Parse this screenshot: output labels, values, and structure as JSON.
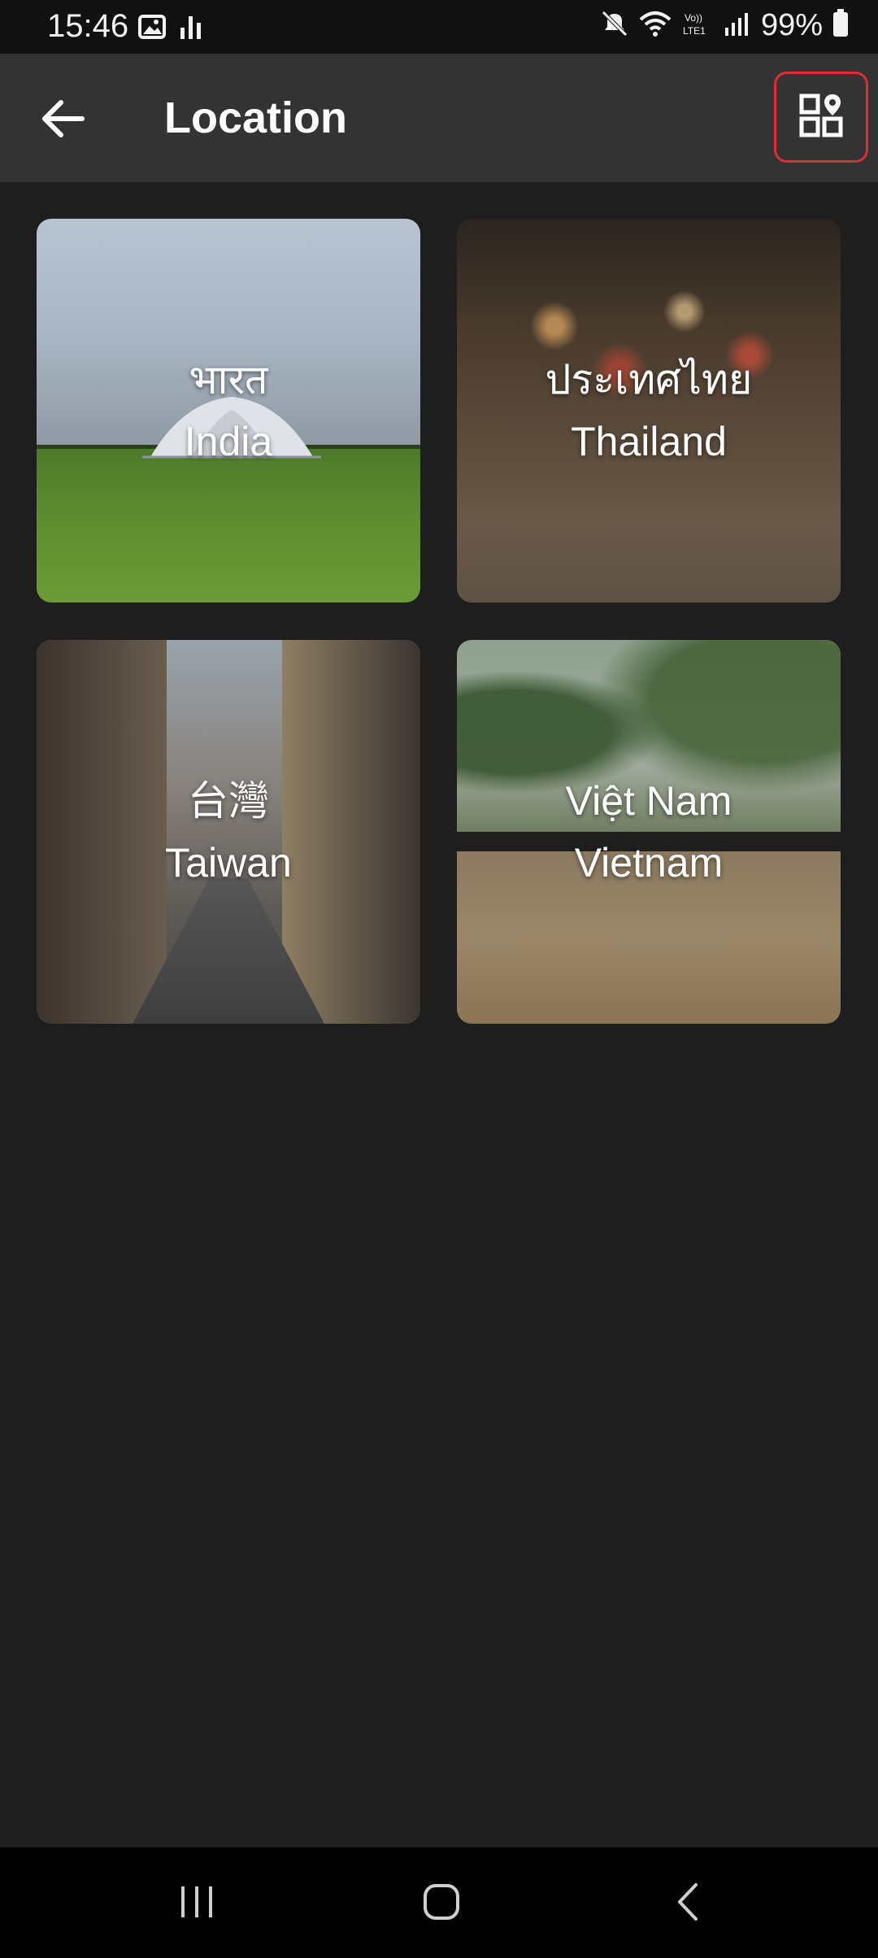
{
  "status_bar": {
    "time": "15:46",
    "battery": "99%",
    "icons": [
      "gallery-icon",
      "audio-bars-icon",
      "mute-icon",
      "wifi-icon",
      "volte-icon",
      "signal-icon",
      "battery-icon"
    ]
  },
  "app_bar": {
    "title": "Location",
    "back_icon": "arrow-left-icon",
    "action_icon": "grid-map-pin-icon"
  },
  "locations": [
    {
      "native_name": "भारत",
      "english_name": "India"
    },
    {
      "native_name": "ประเทศไทย",
      "english_name": "Thailand"
    },
    {
      "native_name": "台灣",
      "english_name": "Taiwan"
    },
    {
      "native_name": "Việt Nam",
      "english_name": "Vietnam"
    }
  ],
  "nav_bar": {
    "icons": [
      "recent-apps-icon",
      "home-icon",
      "back-icon"
    ]
  },
  "colors": {
    "background": "#1e1e1e",
    "app_bar": "#333333",
    "status_bar": "#111111",
    "highlight": "#e12b35"
  }
}
